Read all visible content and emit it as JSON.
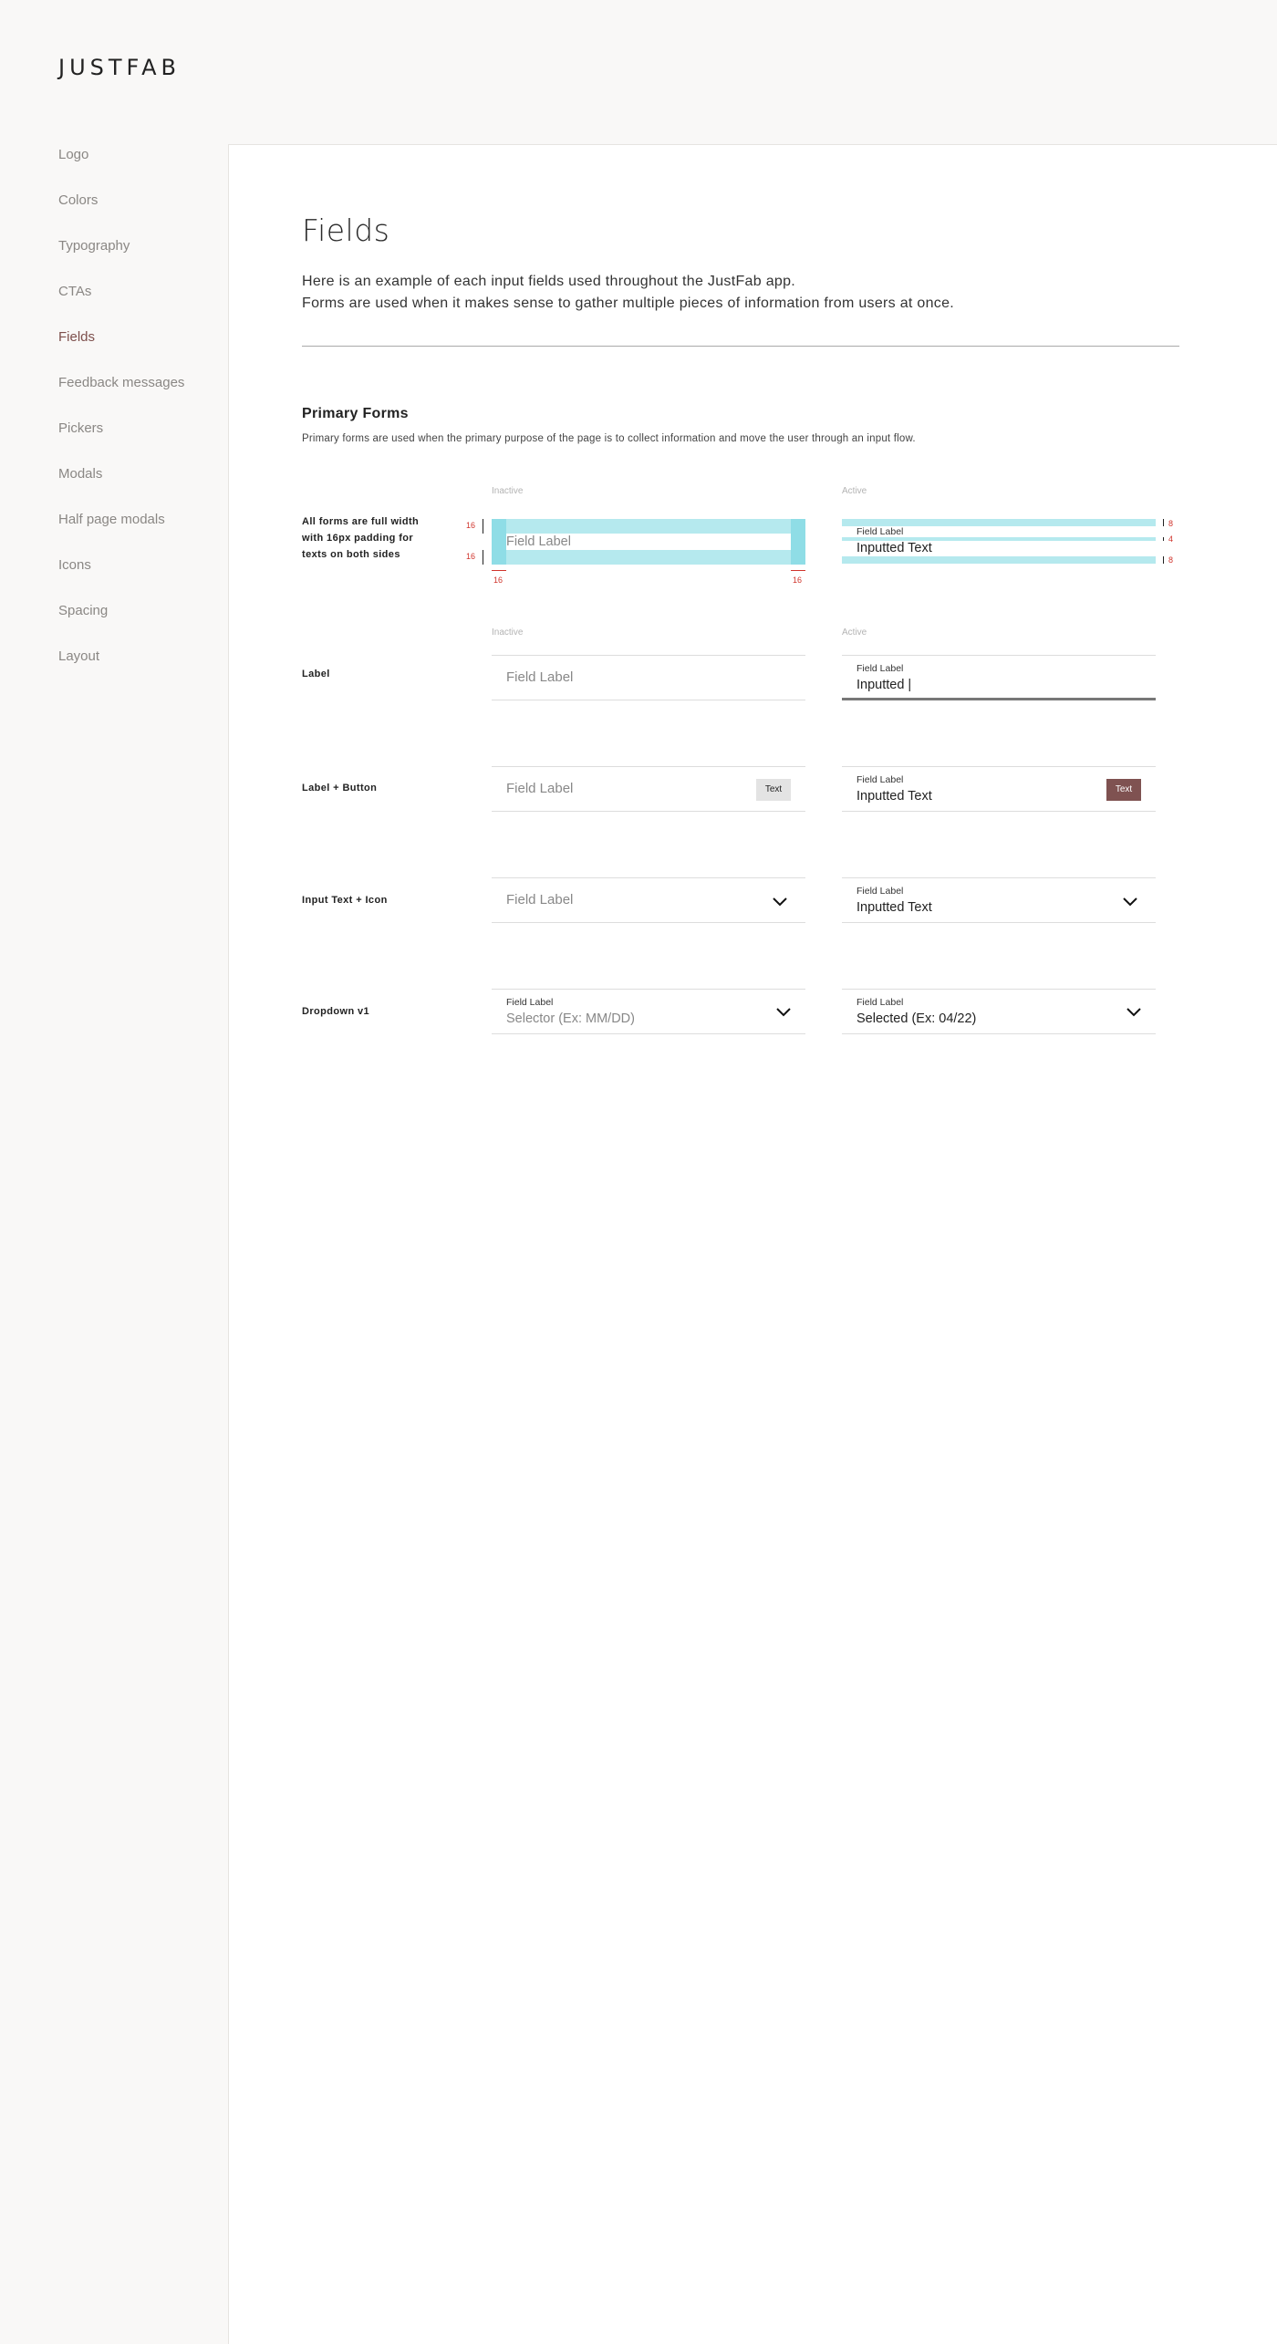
{
  "brand": {
    "logo": "JUSTFAB"
  },
  "sidebar": {
    "items": [
      {
        "label": "Logo",
        "active": false
      },
      {
        "label": "Colors",
        "active": false
      },
      {
        "label": "Typography",
        "active": false
      },
      {
        "label": "CTAs",
        "active": false
      },
      {
        "label": "Fields",
        "active": true
      },
      {
        "label": "Feedback messages",
        "active": false
      },
      {
        "label": "Pickers",
        "active": false
      },
      {
        "label": "Modals",
        "active": false
      },
      {
        "label": "Half page modals",
        "active": false
      },
      {
        "label": "Icons",
        "active": false
      },
      {
        "label": "Spacing",
        "active": false
      },
      {
        "label": "Layout",
        "active": false
      }
    ]
  },
  "page": {
    "title": "Fields",
    "intro_line1": "Here is an example of each input fields used throughout the JustFab app.",
    "intro_line2": "Forms are used when it makes sense to gather multiple pieces of information from users at once."
  },
  "section": {
    "title": "Primary Forms",
    "description": "Primary forms are used when the primary purpose of the page is to collect information and move the user through an input flow."
  },
  "columns": {
    "inactive": "Inactive",
    "active": "Active"
  },
  "spec_row": {
    "label_line1": "All forms are full width",
    "label_line2": "with 16px padding for",
    "label_line3": "texts on both sides",
    "inactive_placeholder": "Field Label",
    "active_label": "Field Label",
    "active_value": "Inputted Text",
    "pad_16": "16",
    "pad_8": "8",
    "pad_4": "4"
  },
  "rows": {
    "label": {
      "name": "Label",
      "inactive_placeholder": "Field Label",
      "active_label": "Field Label",
      "active_value": "Inputted |"
    },
    "label_button": {
      "name": "Label + Button",
      "inactive_placeholder": "Field Label",
      "button_text": "Text",
      "active_label": "Field Label",
      "active_value": "Inputted Text"
    },
    "input_icon": {
      "name": "Input Text + Icon",
      "inactive_placeholder": "Field Label",
      "active_label": "Field Label",
      "active_value": "Inputted Text",
      "icon": "chevron-down-icon"
    },
    "dropdown": {
      "name": "Dropdown v1",
      "inactive_label": "Field Label",
      "inactive_placeholder": "Selector (Ex: MM/DD)",
      "active_label": "Field Label",
      "active_value": "Selected (Ex: 04/22)",
      "icon": "chevron-down-icon"
    }
  },
  "colors": {
    "accent": "#7f5251",
    "spec_cyan": "#b5e9ee",
    "spec_red": "#d0342c"
  }
}
